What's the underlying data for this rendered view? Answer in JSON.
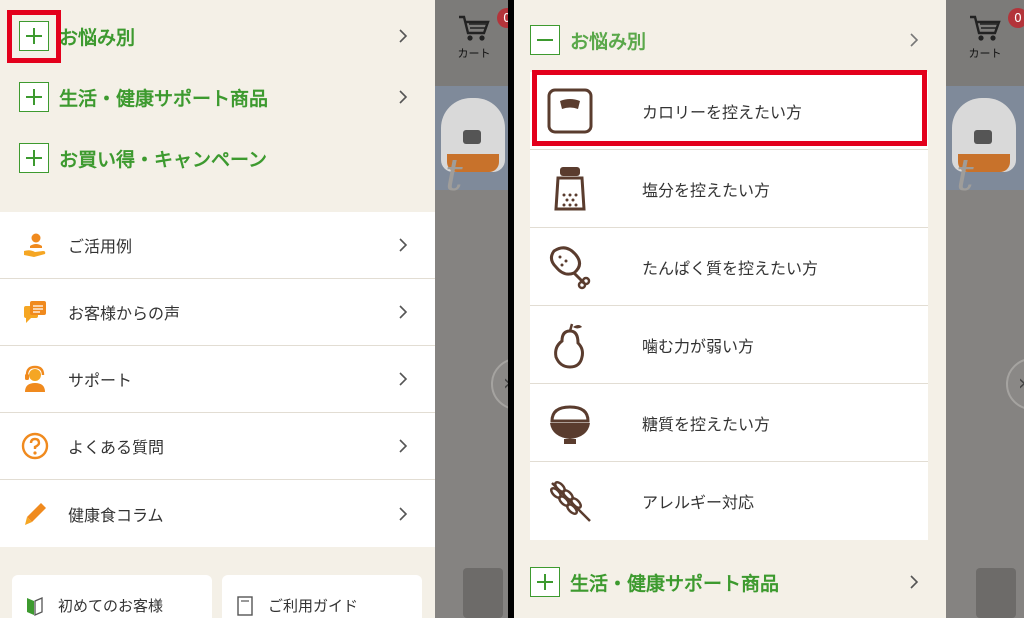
{
  "left": {
    "categories": [
      {
        "label": "お悩み別",
        "icon": "plus-icon"
      },
      {
        "label": "生活・健康サポート商品",
        "icon": "plus-icon"
      },
      {
        "label": "お買い得・キャンペーン",
        "icon": "plus-icon"
      }
    ],
    "links": [
      {
        "label": "ご活用例",
        "icon": "hand-person-icon"
      },
      {
        "label": "お客様からの声",
        "icon": "speech-bubble-icon"
      },
      {
        "label": "サポート",
        "icon": "support-operator-icon"
      },
      {
        "label": "よくある質問",
        "icon": "question-icon"
      },
      {
        "label": "健康食コラム",
        "icon": "pen-icon"
      }
    ],
    "cards": [
      {
        "label": "初めてのお客様",
        "icon": "beginner-mark-icon"
      },
      {
        "label": "ご利用ガイド",
        "icon": "guide-book-icon"
      }
    ]
  },
  "right": {
    "top_category": {
      "label": "お悩み別",
      "icon": "minus-icon"
    },
    "concerns": [
      {
        "label": "カロリーを控えたい方",
        "icon": "scale-icon"
      },
      {
        "label": "塩分を控えたい方",
        "icon": "salt-shaker-icon"
      },
      {
        "label": "たんぱく質を控えたい方",
        "icon": "drumstick-icon"
      },
      {
        "label": "噛む力が弱い方",
        "icon": "pear-icon"
      },
      {
        "label": "糖質を控えたい方",
        "icon": "rice-bowl-icon"
      },
      {
        "label": "アレルギー対応",
        "icon": "wheat-icon"
      }
    ],
    "bottom_category": {
      "label": "生活・健康サポート商品",
      "icon": "plus-icon"
    }
  },
  "cart": {
    "label": "カート",
    "count": "0"
  },
  "colors": {
    "accent_green": "#3d9a2f",
    "highlight_red": "#e3001c",
    "icon_orange": "#f08a1e",
    "icon_brown": "#5a3c2e",
    "menu_bg": "#f4f0e7"
  }
}
